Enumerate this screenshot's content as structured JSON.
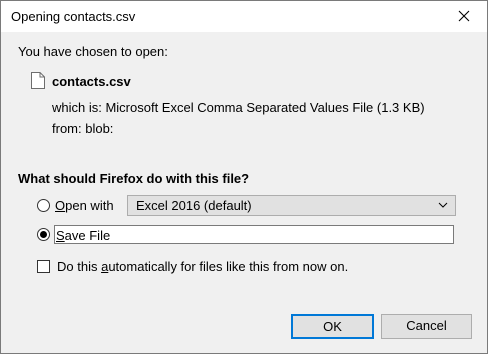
{
  "window": {
    "title": "Opening contacts.csv",
    "close_icon": "close-icon"
  },
  "intro_text": "You have chosen to open:",
  "file": {
    "icon": "file-icon",
    "name": "contacts.csv",
    "which_is": "which is:  Microsoft Excel Comma Separated Values File (1.3 KB)",
    "from": "from:  blob:"
  },
  "question": "What should Firefox do with this file?",
  "options": {
    "open_with": {
      "mnemonic": "O",
      "rest": "pen with",
      "selected": false,
      "app_select_value": "Excel 2016 (default)"
    },
    "save_file": {
      "mnemonic": "S",
      "rest": "ave File",
      "selected": true
    }
  },
  "auto_checkbox": {
    "before": "Do this ",
    "mnemonic": "a",
    "after": "utomatically for files like this from now on.",
    "checked": false
  },
  "buttons": {
    "ok": "OK",
    "cancel": "Cancel"
  },
  "colors": {
    "default_button_border": "#0078d7",
    "dialog_bg": "#f0f0f0"
  }
}
